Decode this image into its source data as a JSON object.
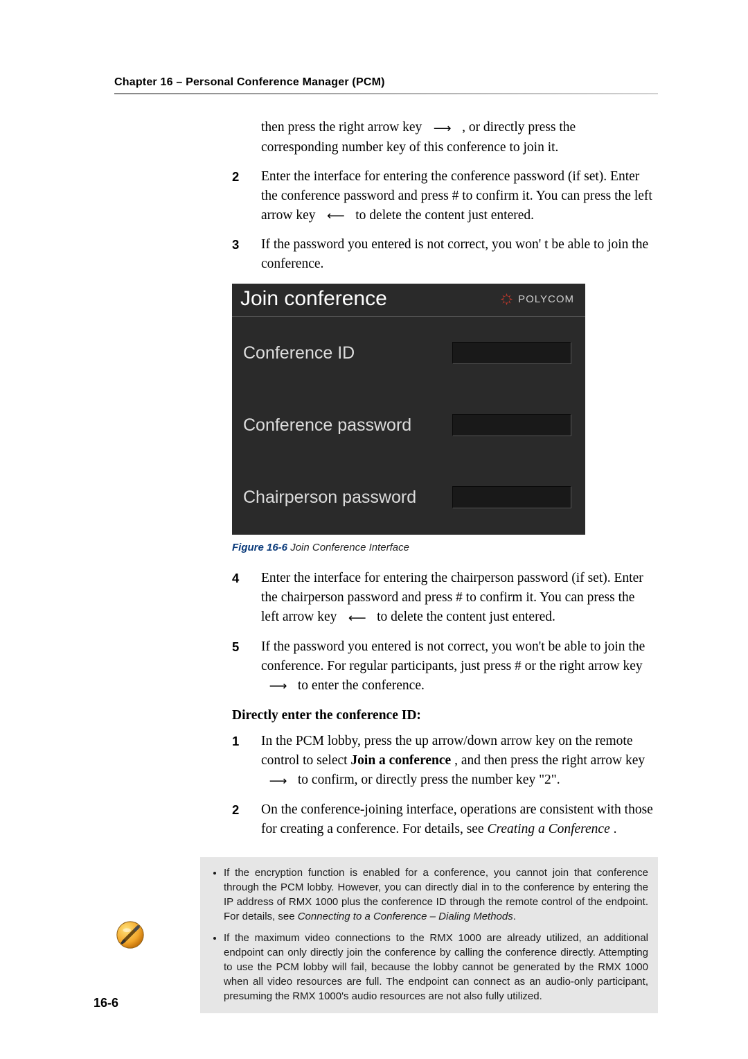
{
  "header": {
    "chapter": "Chapter 16 – Personal Conference Manager (PCM)"
  },
  "content": {
    "intro_part_a": "then press the right arrow key ",
    "intro_part_b": ", or directly press the corresponding number key of this conference to join it.",
    "steps_a": [
      {
        "n": "2",
        "t": "Enter the interface for entering the conference password (if set). Enter the conference password and press # to confirm it. You can press the left arrow key ",
        "t_after_arrow": " to delete the content just entered."
      },
      {
        "n": "3",
        "t": "If the password you entered is not correct, you won' t be able to join the conference."
      }
    ],
    "figure": {
      "title": "Join conference",
      "brand": "POLYCOM",
      "fields": [
        {
          "label": "Conference ID",
          "value": ""
        },
        {
          "label": "Conference password",
          "value": ""
        },
        {
          "label": "Chairperson password",
          "value": ""
        }
      ],
      "caption_label": "Figure 16-6",
      "caption_text": " Join Conference Interface"
    },
    "steps_b": [
      {
        "n": "4",
        "t": "Enter the interface for entering the chairperson password (if set). Enter the chairperson password and press # to confirm it. You can press the left arrow key ",
        "t_after_arrow": " to delete the content just entered."
      },
      {
        "n": "5",
        "t": "If the password you entered is not correct, you won't be able to join the conference. For regular participants, just press # or the right arrow key ",
        "t_after_arrow": " to enter the conference."
      }
    ],
    "subhead": "Directly enter the conference ID:",
    "steps_c": [
      {
        "n": "1",
        "t_a": "In the PCM lobby, press the up arrow/down arrow key on the remote control to select ",
        "bold": "Join a conference",
        "t_b": ", and then press the right arrow key ",
        "t_after_arrow": " to confirm, or directly press the number key \"2\"."
      },
      {
        "n": "2",
        "t_a": "On the conference-joining interface, operations are consistent with those for creating a conference. For details, see ",
        "italic": "Creating a Conference",
        "t_b": "."
      }
    ],
    "note": {
      "bullets": [
        {
          "a": "If the encryption function is enabled for a conference, you cannot join that conference through the PCM lobby. However, you can directly dial in to the conference by entering the IP address of RMX 1000 plus the conference ID through the remote control of the endpoint. For details, see ",
          "em": "Connecting to a Conference – Dialing Methods",
          "b": "."
        },
        {
          "a": "If the maximum video connections to the RMX 1000 are already utilized, an additional endpoint can only directly join the conference by calling the conference directly. Attempting to use the PCM lobby will fail, because the lobby cannot be generated by the RMX 1000 when all video resources are full. The endpoint can connect as an audio-only participant, presuming the RMX 1000's audio resources are not also fully utilized."
        }
      ]
    }
  },
  "arrows": {
    "right": "⟶",
    "left": "⟵"
  },
  "page_number": "16-6"
}
